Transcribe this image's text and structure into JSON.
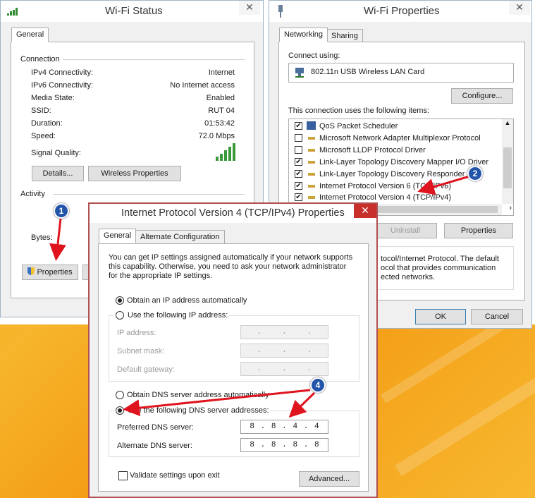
{
  "wifi_status": {
    "title": "Wi-Fi Status",
    "close": "✕",
    "tab_general": "General",
    "connection_header": "Connection",
    "rows": [
      {
        "label": "IPv4 Connectivity:",
        "value": "Internet"
      },
      {
        "label": "IPv6 Connectivity:",
        "value": "No Internet access"
      },
      {
        "label": "Media State:",
        "value": "Enabled"
      },
      {
        "label": "SSID:",
        "value": "RUT 04"
      },
      {
        "label": "Duration:",
        "value": "01:53:42"
      },
      {
        "label": "Speed:",
        "value": "72.0 Mbps"
      }
    ],
    "signal_label": "Signal Quality:",
    "details_btn": "Details...",
    "wireless_props_btn": "Wireless Properties",
    "activity_header": "Activity",
    "bytes_label": "Bytes:",
    "properties_btn": "Properties"
  },
  "wifi_properties": {
    "title": "Wi-Fi Properties",
    "close": "✕",
    "tab_networking": "Networking",
    "tab_sharing": "Sharing",
    "connect_using": "Connect using:",
    "adapter": "802.11n USB Wireless LAN Card",
    "configure_btn": "Configure...",
    "items_label": "This connection uses the following items:",
    "items": [
      {
        "label": "QoS Packet Scheduler",
        "checked": true
      },
      {
        "label": "Microsoft Network Adapter Multiplexor Protocol",
        "checked": false
      },
      {
        "label": "Microsoft LLDP Protocol Driver",
        "checked": false
      },
      {
        "label": "Link-Layer Topology Discovery Mapper I/O Driver",
        "checked": true
      },
      {
        "label": "Link-Layer Topology Discovery Responder",
        "checked": true
      },
      {
        "label": "Internet Protocol Version 6 (TCP/IPv6)",
        "checked": true
      },
      {
        "label": "Internet Protocol Version 4 (TCP/IPv4)",
        "checked": true
      }
    ],
    "uninstall_btn": "Uninstall",
    "properties_btn": "Properties",
    "desc_line1": "tocol/Internet Protocol. The default",
    "desc_line2": "ocol that provides communication",
    "desc_line3": "ected networks.",
    "ok_btn": "OK",
    "cancel_btn": "Cancel"
  },
  "ipv4": {
    "title": "Internet Protocol Version 4 (TCP/IPv4) Properties",
    "close": "✕",
    "tab_general": "General",
    "tab_alternate": "Alternate Configuration",
    "intro_1": "You can get IP settings assigned automatically if your network supports",
    "intro_2": "this capability. Otherwise, you need to ask your network administrator",
    "intro_3": "for the appropriate IP settings.",
    "obtain_ip_auto": "Obtain an IP address automatically",
    "use_following_ip": "Use the following IP address:",
    "ip_address_label": "IP address:",
    "subnet_label": "Subnet mask:",
    "gateway_label": "Default gateway:",
    "obtain_dns_auto": "Obtain DNS server address automatically",
    "use_following_dns": "Use the following DNS server addresses:",
    "preferred_dns_label": "Preferred DNS server:",
    "preferred_dns": [
      "8",
      "8",
      "4",
      "4"
    ],
    "alternate_dns_label": "Alternate DNS server:",
    "alternate_dns": [
      "8",
      "8",
      "8",
      "8"
    ],
    "validate_label": "Validate settings upon exit",
    "advanced_btn": "Advanced..."
  },
  "annotations": {
    "badge_1": "1",
    "badge_2": "2",
    "badge_4": "4",
    "arrow_color": "#e0141e",
    "badge_color": "#2255aa"
  }
}
